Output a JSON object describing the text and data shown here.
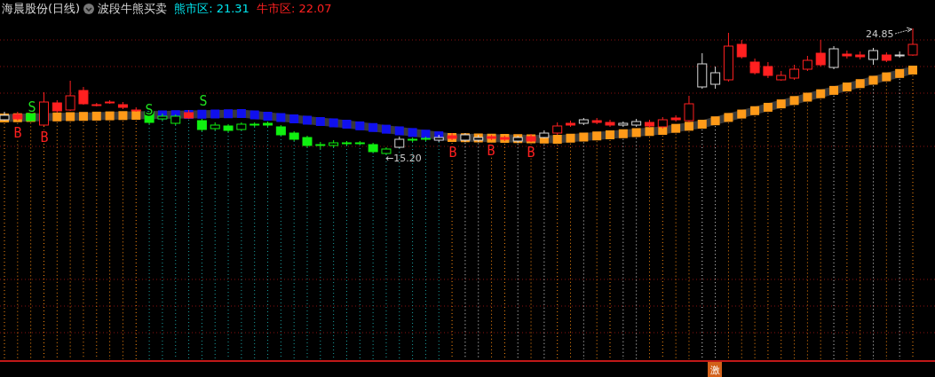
{
  "header": {
    "stock_title": "海晨股份(日线)",
    "indicator_name": "波段牛熊买卖",
    "values": [
      {
        "label": "熊市区: ",
        "value": "21.31",
        "color": "#00e5ee"
      },
      {
        "label": "牛市区: ",
        "value": "22.07",
        "color": "#ff2020"
      }
    ]
  },
  "signals": [
    {
      "kind": "buy",
      "label": "B"
    },
    {
      "kind": "sell",
      "label": "S"
    },
    {
      "kind": "buy",
      "label": "B"
    },
    {
      "kind": "sell",
      "label": "S"
    },
    {
      "kind": "sell",
      "label": "S"
    },
    {
      "kind": "buy",
      "label": "B"
    },
    {
      "kind": "buy",
      "label": "B"
    },
    {
      "kind": "buy",
      "label": "B"
    }
  ],
  "price_labels": [
    {
      "kind": "low",
      "text": "←15.20"
    },
    {
      "kind": "high",
      "text": "24.85"
    }
  ],
  "badge": {
    "text": "激"
  }
}
